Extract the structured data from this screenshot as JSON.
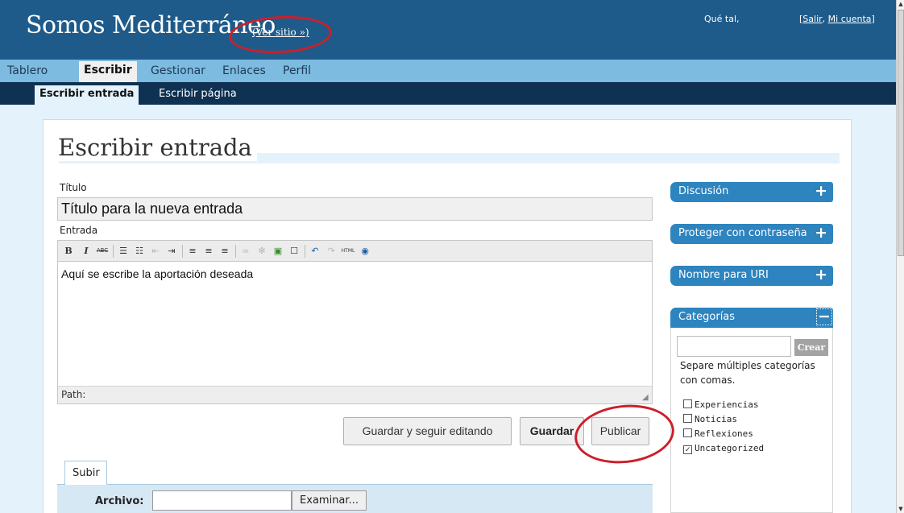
{
  "header": {
    "site_title": "Somos Mediterráneo",
    "view_site": "(Ver sitio »)",
    "greeting": "Qué tal,",
    "bracket_open": "[",
    "logout": "Salir",
    "comma": ", ",
    "my_account": "Mi cuenta",
    "bracket_close": "]"
  },
  "main_nav": [
    "Tablero",
    "Escribir",
    "Gestionar",
    "Enlaces",
    "Perfil"
  ],
  "sub_nav": [
    "Escribir entrada",
    "Escribir página"
  ],
  "page_title": "Escribir entrada",
  "form": {
    "title_label": "Título",
    "title_value": "Título para la nueva entrada",
    "entry_label": "Entrada",
    "content": "Aquí se escribe la aportación deseada",
    "path_label": "Path:"
  },
  "toolbar": {
    "bold": "B",
    "italic": "I",
    "strike": "ABC",
    "html": "HTML"
  },
  "buttons": {
    "save_continue": "Guardar y seguir editando",
    "save": "Guardar",
    "publish": "Publicar"
  },
  "upload": {
    "tab": "Subir",
    "file_label": "Archivo:",
    "browse": "Examinar..."
  },
  "sidebar": {
    "discussion": "Discusión",
    "password": "Proteger con contraseña",
    "uri_name": "Nombre para URI",
    "categories": "Categorías",
    "create": "Crear",
    "hint": "Separe múltiples categorías con comas.",
    "category_items": [
      {
        "label": "Experiencias",
        "checked": false
      },
      {
        "label": "Noticias",
        "checked": false
      },
      {
        "label": "Reflexiones",
        "checked": false
      },
      {
        "label": "Uncategorized",
        "checked": true
      }
    ],
    "expand_symbol": "+",
    "collapse_symbol": "−"
  },
  "colors": {
    "header": "#1e5b8a",
    "nav": "#7dbbe0",
    "subnav": "#0f3152",
    "sidebar_head": "#2d84bf",
    "annotation": "#cc1f2b"
  }
}
